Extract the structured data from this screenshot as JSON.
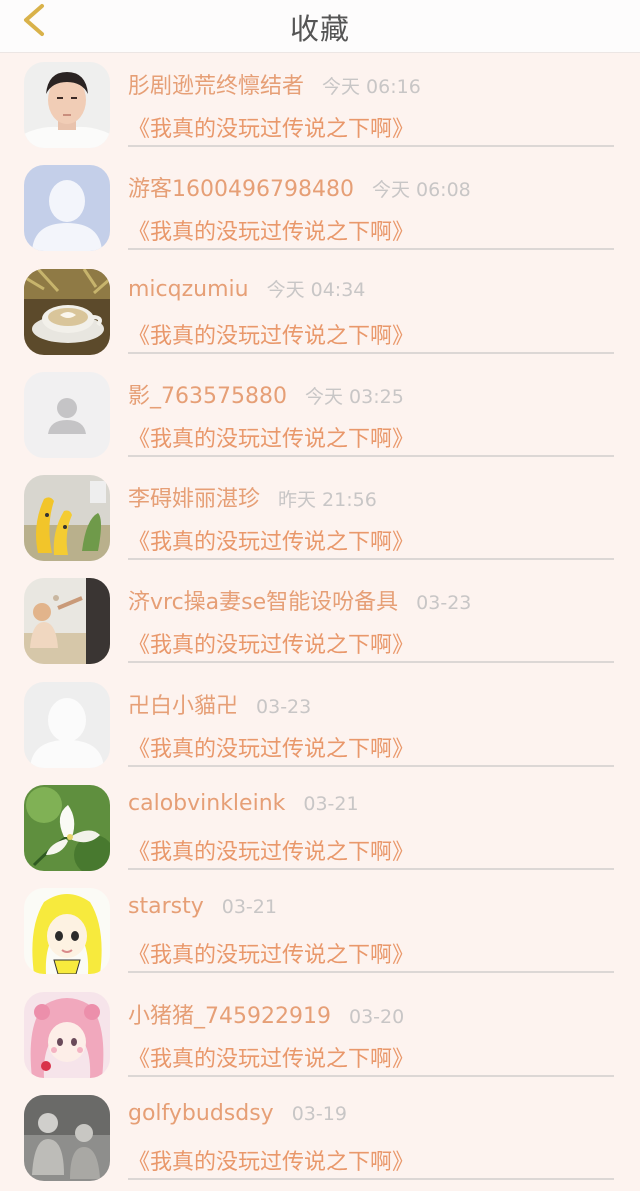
{
  "header": {
    "title": "收藏",
    "back_icon": "chevron-left-icon"
  },
  "colors": {
    "accent": "#e69f76",
    "link": "#e9986b",
    "time": "#c8c6c6",
    "background": "#fdf3ef",
    "back_icon": "#d9b24a"
  },
  "items": [
    {
      "name": "肜剧逊荒终懔结者",
      "time": "今天 06:16",
      "link": "《我真的没玩过传说之下啊》",
      "avatar": "man-portrait"
    },
    {
      "name": "游客1600496798480",
      "time": "今天 06:08",
      "link": "《我真的没玩过传说之下啊》",
      "avatar": "default-silhouette-blue"
    },
    {
      "name": "micqzumiu",
      "time": "今天 04:34",
      "link": "《我真的没玩过传说之下啊》",
      "avatar": "coffee-cup"
    },
    {
      "name": "影_763575880",
      "time": "今天 03:25",
      "link": "《我真的没玩过传说之下啊》",
      "avatar": "default-silhouette-gray"
    },
    {
      "name": "李碍婔丽湛珍",
      "time": "昨天 21:56",
      "link": "《我真的没玩过传说之下啊》",
      "avatar": "banana-figures"
    },
    {
      "name": "济vrc操a妻se智能设吩备具",
      "time": "03-23",
      "link": "《我真的没玩过传说之下啊》",
      "avatar": "kids-photo"
    },
    {
      "name": "卍白小貓卍",
      "time": "03-23",
      "link": "《我真的没玩过传说之下啊》",
      "avatar": "default-silhouette-white"
    },
    {
      "name": "calobvinkleink",
      "time": "03-21",
      "link": "《我真的没玩过传说之下啊》",
      "avatar": "white-flower"
    },
    {
      "name": "starsty",
      "time": "03-21",
      "link": "《我真的没玩过传说之下啊》",
      "avatar": "anime-yellow-hair"
    },
    {
      "name": "小猪猪_745922919",
      "time": "03-20",
      "link": "《我真的没玩过传说之下啊》",
      "avatar": "anime-pink-hair"
    },
    {
      "name": "golfybudsdsy",
      "time": "03-19",
      "link": "《我真的没玩过传说之下啊》",
      "avatar": "gray-photo"
    }
  ]
}
